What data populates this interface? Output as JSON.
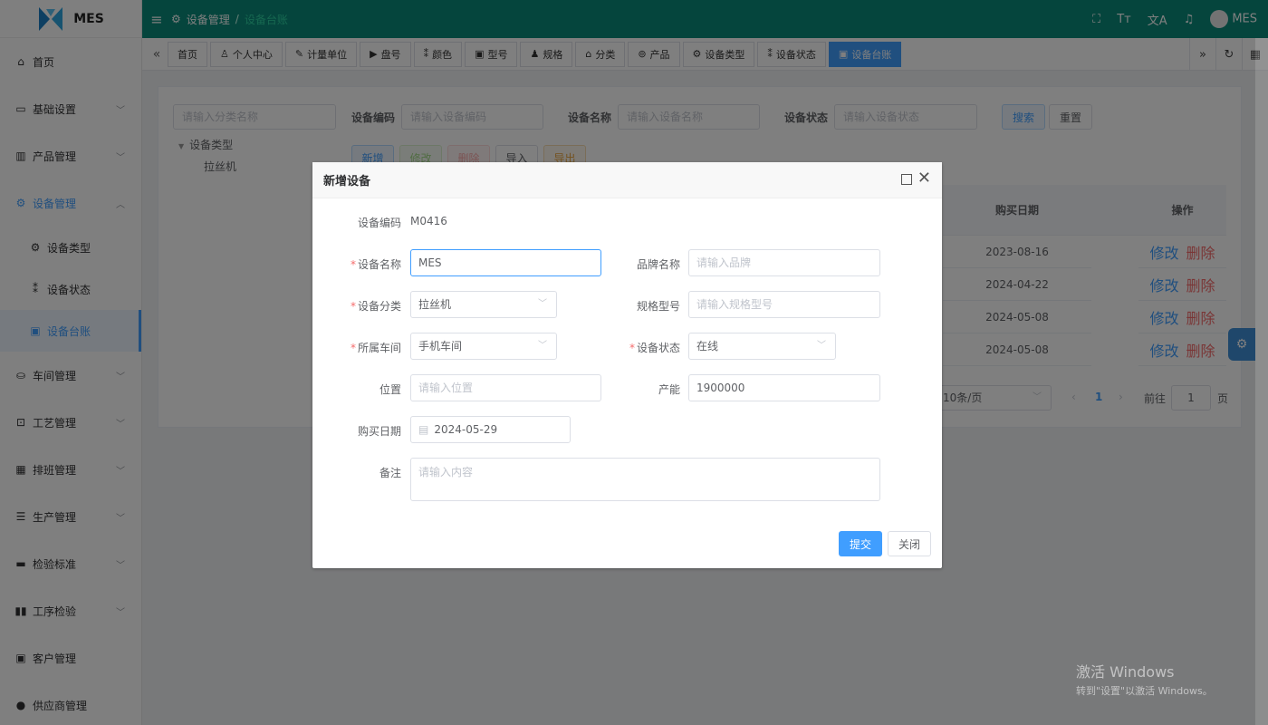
{
  "app": {
    "name": "MES"
  },
  "sidebar": {
    "items": [
      {
        "label": "首页",
        "icon": "home-icon"
      },
      {
        "label": "基础设置",
        "icon": "settings-icon"
      },
      {
        "label": "产品管理",
        "icon": "chart-icon"
      },
      {
        "label": "设备管理",
        "icon": "device-icon"
      },
      {
        "label": "车间管理",
        "icon": "workshop-icon"
      },
      {
        "label": "工艺管理",
        "icon": "process-icon"
      },
      {
        "label": "排班管理",
        "icon": "calendar-icon"
      },
      {
        "label": "生产管理",
        "icon": "production-icon"
      },
      {
        "label": "检验标准",
        "icon": "monitor-icon"
      },
      {
        "label": "工序检验",
        "icon": "book-icon"
      },
      {
        "label": "客户管理",
        "icon": "customer-icon"
      },
      {
        "label": "供应商管理",
        "icon": "user-icon"
      }
    ],
    "submenu": [
      {
        "label": "设备类型"
      },
      {
        "label": "设备状态"
      },
      {
        "label": "设备台账"
      }
    ]
  },
  "header": {
    "breadcrumb_1": "设备管理",
    "breadcrumb_sep": "/",
    "breadcrumb_2": "设备台账",
    "user": "MES"
  },
  "tags": [
    "首页",
    "个人中心",
    "计量单位",
    "盘号",
    "颜色",
    "型号",
    "规格",
    "分类",
    "产品",
    "设备类型",
    "设备状态",
    "设备台账"
  ],
  "search": {
    "category_placeholder": "请输入分类名称",
    "code_label": "设备编码",
    "code_placeholder": "请输入设备编码",
    "name_label": "设备名称",
    "name_placeholder": "请输入设备名称",
    "status_label": "设备状态",
    "status_placeholder": "请输入设备状态",
    "search_btn": "搜索",
    "reset_btn": "重置"
  },
  "toolbar": {
    "add": "新增",
    "edit": "修改",
    "delete": "删除",
    "import": "导入",
    "export": "导出"
  },
  "tree": {
    "root": "设备类型",
    "child": "拉丝机"
  },
  "table": {
    "headers": {
      "purchase_date": "购买日期",
      "ops": "操作"
    },
    "rows": [
      {
        "date": "2023-08-16",
        "edit": "修改",
        "del": "删除"
      },
      {
        "date": "2024-04-22",
        "edit": "修改",
        "del": "删除"
      },
      {
        "date": "2024-05-08",
        "edit": "修改",
        "del": "删除"
      },
      {
        "date": "2024-05-08",
        "edit": "修改",
        "del": "删除"
      }
    ]
  },
  "pagination": {
    "page_size": "10条/页",
    "current": "1",
    "goto_label": "前往",
    "goto_value": "1",
    "page_suffix": "页"
  },
  "dialog": {
    "title": "新增设备",
    "code_label": "设备编码",
    "code_value": "M0416",
    "name_label": "设备名称",
    "name_value": "MES",
    "brand_label": "品牌名称",
    "brand_placeholder": "请输入品牌",
    "category_label": "设备分类",
    "category_value": "拉丝机",
    "spec_label": "规格型号",
    "spec_placeholder": "请输入规格型号",
    "workshop_label": "所属车间",
    "workshop_value": "手机车间",
    "status_label": "设备状态",
    "status_value": "在线",
    "location_label": "位置",
    "location_placeholder": "请输入位置",
    "capacity_label": "产能",
    "capacity_value": "1900000",
    "date_label": "购买日期",
    "date_value": "2024-05-29",
    "remark_label": "备注",
    "remark_placeholder": "请输入内容",
    "submit": "提交",
    "close": "关闭"
  },
  "watermark": {
    "line1": "激活 Windows",
    "line2": "转到\"设置\"以激活 Windows。"
  },
  "colors": {
    "header": "#0a8a7a",
    "primary": "#409eff",
    "danger": "#f56c6c"
  }
}
